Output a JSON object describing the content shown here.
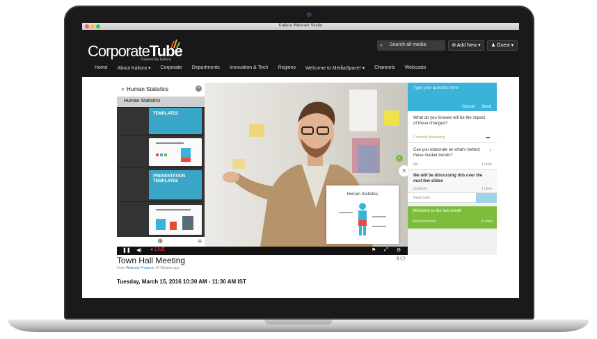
{
  "window": {
    "title": "Kaltura Webcast Studio",
    "traffic_lights": [
      "#fc605c",
      "#fdbc40",
      "#34c84a"
    ]
  },
  "header": {
    "logo_light": "Corporate",
    "logo_bold": "Tube",
    "logo_sub": "Powered by Kaltura",
    "search_placeholder": "Search all media",
    "add_new": "⊕ Add New ▾",
    "guest": "♟ Guest ▾",
    "nav": [
      "Home",
      "About Kaltura ▾",
      "Corporate",
      "Departments",
      "Innovation & Tech",
      "Regions",
      "Welcome to MediaSpace! ▾",
      "Channels",
      "Webcasts"
    ]
  },
  "slides_panel": {
    "search_value": "Human Statistics",
    "result": "Human Statistics",
    "thumbs": [
      {
        "title": "TEMPLATES",
        "style": "teal"
      },
      {
        "title": "",
        "style": "white"
      },
      {
        "title": "PRESENTATION TEMPLATES",
        "style": "teal"
      },
      {
        "title": "",
        "style": "white"
      },
      {
        "title": "",
        "style": "white"
      }
    ]
  },
  "video": {
    "slide_title": "Human Statistics"
  },
  "controls": {
    "play": "❚❚",
    "volume": "◀)",
    "live": "● LIVE",
    "flag": "⚑",
    "fullscreen": "⤢",
    "settings": "⚙"
  },
  "qa": {
    "placeholder": "Type your question here",
    "cancel": "Cancel",
    "send": "Send",
    "items": [
      {
        "question": "What do you foresee will be the impact of these changes?",
        "meta": "Currently Answering",
        "meta_color": "#7cbd3b"
      },
      {
        "question": "Can you elaborate on what's behind these market trends?",
        "meta": "Me",
        "time": "1 mins"
      },
      {
        "question": "We will be discussing this over the next few slides",
        "meta": "producer",
        "time": "1 mins"
      },
      {
        "question": "Reply here",
        "meta": "",
        "time": ""
      }
    ],
    "welcome": {
      "text": "Welcome to the live event!",
      "sender": "Announcement",
      "time": "10 mins"
    }
  },
  "event": {
    "title": "Town Hall Meeting",
    "from_prefix": "From",
    "from_user": "Webcast Producer",
    "from_suffix": "20 Minutes ago",
    "comments": "0 💬",
    "date": "Tuesday, March 15, 2016   10:30 AM - 11:30 AM IST"
  }
}
